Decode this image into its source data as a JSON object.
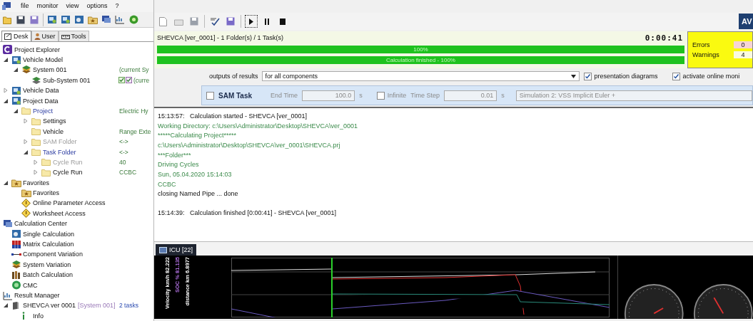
{
  "menu": [
    "file",
    "monitor",
    "view",
    "options",
    "?"
  ],
  "left_tabs": [
    {
      "label": "Desk",
      "selected": true
    },
    {
      "label": "User",
      "selected": false
    },
    {
      "label": "Tools",
      "selected": false
    }
  ],
  "tree": [
    {
      "label": "Project Explorer",
      "kind": "app",
      "children": [
        {
          "label": "Vehicle Model",
          "kind": "model",
          "expanded": true,
          "children": [
            {
              "label": "System 001",
              "kind": "system",
              "value": "(current Sy",
              "expanded": true,
              "children": [
                {
                  "label": "Sub-System 001",
                  "kind": "subsystem",
                  "value": "(curre",
                  "checked": true
                }
              ]
            }
          ]
        },
        {
          "label": "Vehicle Data",
          "kind": "model",
          "expanded": false
        },
        {
          "label": "Project Data",
          "kind": "model",
          "expanded": true,
          "children": [
            {
              "label": "Project",
              "kind": "folder",
              "active": true,
              "value": "Electric Hy",
              "expanded": true,
              "children": [
                {
                  "label": "Settings",
                  "kind": "folder",
                  "active": false,
                  "expanded": false
                },
                {
                  "label": "Vehicle",
                  "kind": "folder",
                  "active": false,
                  "value": "Range Exte"
                },
                {
                  "label": "SAM Folder",
                  "kind": "folder",
                  "active": false,
                  "disabled": true,
                  "value": "<->",
                  "expanded": false
                },
                {
                  "label": "Task Folder",
                  "kind": "folder",
                  "active": true,
                  "value": "<->",
                  "expanded": true,
                  "children": [
                    {
                      "label": "Cycle Run",
                      "kind": "folder",
                      "active": false,
                      "disabled": true,
                      "value": "40",
                      "expanded": false
                    },
                    {
                      "label": "Cycle Run",
                      "kind": "folder",
                      "active": false,
                      "value": "CCBC",
                      "expanded": false
                    }
                  ]
                }
              ]
            }
          ]
        },
        {
          "label": "Favorites",
          "kind": "favorites",
          "expanded": true,
          "children": [
            {
              "label": "Favorites",
              "kind": "favorites"
            },
            {
              "label": "Online Parameter Access",
              "kind": "access"
            },
            {
              "label": "Worksheet Access",
              "kind": "access"
            }
          ]
        }
      ]
    },
    {
      "label": "Calculation Center",
      "kind": "center",
      "children": [
        {
          "label": "Single Calculation",
          "kind": "single"
        },
        {
          "label": "Matrix Calculation",
          "kind": "matrix"
        },
        {
          "label": "Component Variation",
          "kind": "variation"
        },
        {
          "label": "System Variation",
          "kind": "system"
        },
        {
          "label": "Batch Calculation",
          "kind": "batch"
        },
        {
          "label": "CMC",
          "kind": "cmc"
        }
      ]
    },
    {
      "label": "Result Manager",
      "kind": "results",
      "children": [
        {
          "label": "SHEVCA ver 0001",
          "tag": "[System 001]",
          "kind": "result",
          "value": "2 tasks",
          "expanded": true,
          "children": [
            {
              "label": "Info",
              "kind": "info"
            }
          ]
        }
      ]
    }
  ],
  "logo": "AV",
  "run": {
    "title": "SHEVCA [ver_0001] - 1 Folder(s) / 1 Task(s)",
    "elapsed": "0:00:41",
    "progress": [
      {
        "label": "100%",
        "level": 1
      },
      {
        "label": "Calculation finished - 100%",
        "level": 1
      }
    ],
    "errors": {
      "label": "Errors",
      "value": "0"
    },
    "warnings": {
      "label": "Warnings",
      "value": "4"
    }
  },
  "options": {
    "label": "outputs of results",
    "value": "for all components",
    "checks": [
      {
        "label": "presentation diagrams",
        "checked": true
      },
      {
        "label": "activate online moni",
        "checked": true
      }
    ]
  },
  "task": {
    "checked": false,
    "name": "SAM Task",
    "end_time_label": "End Time",
    "end_time": "100.0",
    "end_unit": "s",
    "infinite": {
      "label": "Infinite",
      "checked": false
    },
    "time_step_label": "Time Step",
    "time_step": "0.01",
    "step_unit": "s",
    "solver": "Simulation 2: VSS Implicit Euler +"
  },
  "log": [
    {
      "time": "15:13:57:",
      "text": "Calculation started - SHEVCA [ver_0001]",
      "details": [
        {
          "text": "Working Directory: c:\\Users\\Administrator\\Desktop\\SHEVCA\\ver_0001",
          "kind": "info"
        },
        {
          "text": "*****Calculating Project*****",
          "kind": "info"
        },
        {
          "text": "c:\\Users\\Administrator\\Desktop\\SHEVCA\\ver_0001\\SHEVCA.prj",
          "kind": "info"
        },
        {
          "text": "***Folder***",
          "kind": "info"
        },
        {
          "text": "Driving Cycles",
          "kind": "info"
        },
        {
          "text": "Sun, 05.04.2020 15:14:03",
          "kind": "info"
        },
        {
          "text": "CCBC",
          "kind": "info"
        },
        {
          "text": "closing Named Pipe ... done",
          "kind": "plain"
        }
      ]
    },
    {
      "time": "15:14:39:",
      "text": "Calculation finished [0:00:41] - SHEVCA [ver_0001]"
    }
  ],
  "monitor_tabs": [
    {
      "label": "ICU [22]",
      "selected": true
    }
  ],
  "signals": [
    {
      "label": "Velocity km/h 82.222",
      "color": "#ffffff"
    },
    {
      "label": "SOC % 81.135",
      "color": "#b070e0"
    },
    {
      "label": "distance km 6.8977",
      "color": "#ffffff"
    }
  ]
}
